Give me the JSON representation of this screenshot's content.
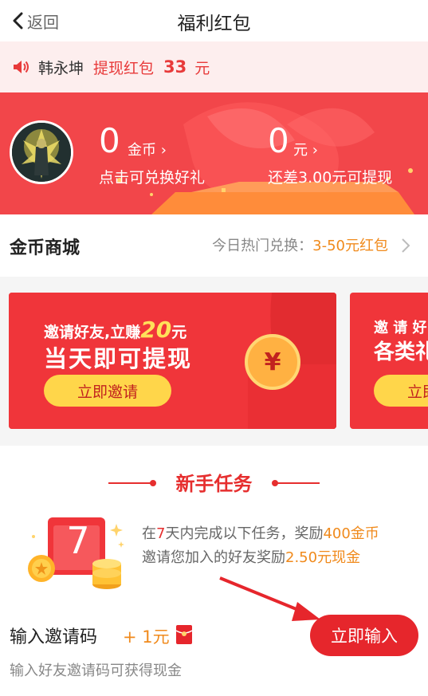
{
  "header": {
    "back_label": "返回",
    "title": "福利红包"
  },
  "notice": {
    "user": "韩永坤",
    "action": "提现红包",
    "amount": "33",
    "unit": "元"
  },
  "wallet": {
    "coins_value": "0",
    "coins_unit": "金币",
    "coins_hint": "点击可兑换好礼",
    "cash_value": "0",
    "cash_unit": "元",
    "cash_hint": "还差3.00元可提现"
  },
  "mall": {
    "title": "金币商城",
    "hot_prefix": "今日热门兑换：",
    "hot_value": "3-50元红包"
  },
  "promo_cards": [
    {
      "line1_prefix": "邀请好友,立赚",
      "line1_amount": "20",
      "line1_suffix": "元",
      "line2": "当天即可提现",
      "button": "立即邀请",
      "coin_symbol": "¥"
    },
    {
      "line1_prefix": "邀 请 好",
      "line2": "各类礼",
      "button": "立即"
    }
  ],
  "newbie": {
    "title": "新手任务",
    "calendar_number": "7",
    "task_line1": {
      "p1": "在",
      "days": "7",
      "p2": "天内完成以下任务，奖励",
      "reward": "400金币"
    },
    "task_line2": {
      "p1": "邀请您加入的好友奖励",
      "reward": "2.50元现金"
    },
    "invite_code_label": "输入邀请码",
    "invite_code_reward": "+ 1元",
    "invite_button": "立即输入",
    "invite_hint": "输入好友邀请码可获得现金"
  },
  "colors": {
    "primary_red": "#e6262c",
    "accent_orange": "#f08a1c",
    "banner_red": "#f2464a"
  }
}
